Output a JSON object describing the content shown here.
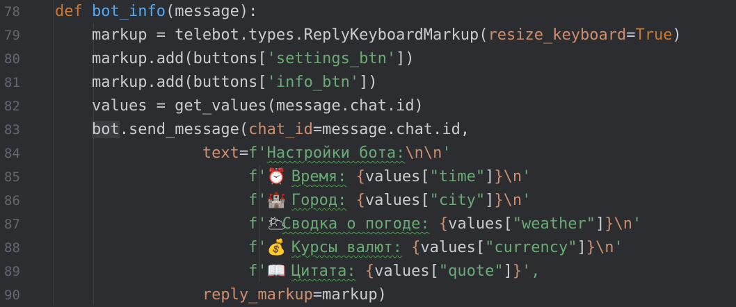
{
  "line_numbers": [
    "78",
    "79",
    "80",
    "81",
    "82",
    "83",
    "84",
    "85",
    "86",
    "87",
    "88",
    "89",
    "90"
  ],
  "lines": {
    "l78": {
      "def": "def ",
      "name": "bot_info",
      "rest": "(message):"
    },
    "l79": {
      "a": "    markup = telebot.types.ReplyKeyboardMarkup(",
      "param": "resize_keyboard",
      "b": "=",
      "kw": "True",
      "c": ")"
    },
    "l80": {
      "a": "    markup.add(buttons[",
      "str": "'settings_btn'",
      "c": "])"
    },
    "l81": {
      "a": "    markup.add(buttons[",
      "str": "'info_btn'",
      "c": "])"
    },
    "l82": {
      "a": "    values = get_values(message.chat.id)"
    },
    "l83": {
      "indent": "    ",
      "bot": "bot",
      "a": ".send_message(",
      "param": "chat_id",
      "b": "=message.chat.id,"
    },
    "l84": {
      "indent": "                ",
      "param": "text",
      "b": "=",
      "pre": "f'",
      "txt": "Настройки бота:",
      "esc": "\\n\\n",
      "post": "'"
    },
    "l85": {
      "indent": "                     ",
      "pre": "f'",
      "icon": "⏰",
      "sp": " ",
      "txt": "Время:",
      "s2": " ",
      "o": "{",
      "mid": "values[",
      "key": "\"time\"",
      "cl": "]",
      "c": "}",
      "esc": "\\n",
      "post": "'"
    },
    "l86": {
      "indent": "                     ",
      "pre": "f'",
      "icon": "🏰",
      "sp": " ",
      "txt": "Город:",
      "s2": " ",
      "o": "{",
      "mid": "values[",
      "key": "\"city\"",
      "cl": "]",
      "c": "}",
      "esc": "\\n",
      "post": "'"
    },
    "l87": {
      "indent": "                     ",
      "pre": "f'",
      "icon": "🌥",
      "sp": "",
      "txt": "Сводка о погоде:",
      "s2": " ",
      "o": "{",
      "mid": "values[",
      "key": "\"weather\"",
      "cl": "]",
      "c": "}",
      "esc": "\\n",
      "post": "'"
    },
    "l88": {
      "indent": "                     ",
      "pre": "f'",
      "icon": "💰",
      "sp": " ",
      "txt": "Курсы валют:",
      "s2": " ",
      "o": "{",
      "mid": "values[",
      "key": "\"currency\"",
      "cl": "]",
      "c": "}",
      "esc": "\\n",
      "post": "'"
    },
    "l89": {
      "indent": "                     ",
      "pre": "f'",
      "icon": "📖",
      "sp": " ",
      "txt": "Цитата:",
      "s2": " ",
      "o": "{",
      "mid": "values[",
      "key": "\"quote\"",
      "cl": "]",
      "c": "}",
      "post": "',"
    },
    "l90": {
      "indent": "                ",
      "param": "reply_markup",
      "b": "=markup)"
    }
  },
  "colors": {
    "background": "#2b2d31",
    "keyword": "#cc7832",
    "function": "#56a8f5",
    "string": "#6aab73",
    "parameter": "#cf8e6d",
    "text": "#c9ccd1",
    "line_number": "#636770"
  }
}
